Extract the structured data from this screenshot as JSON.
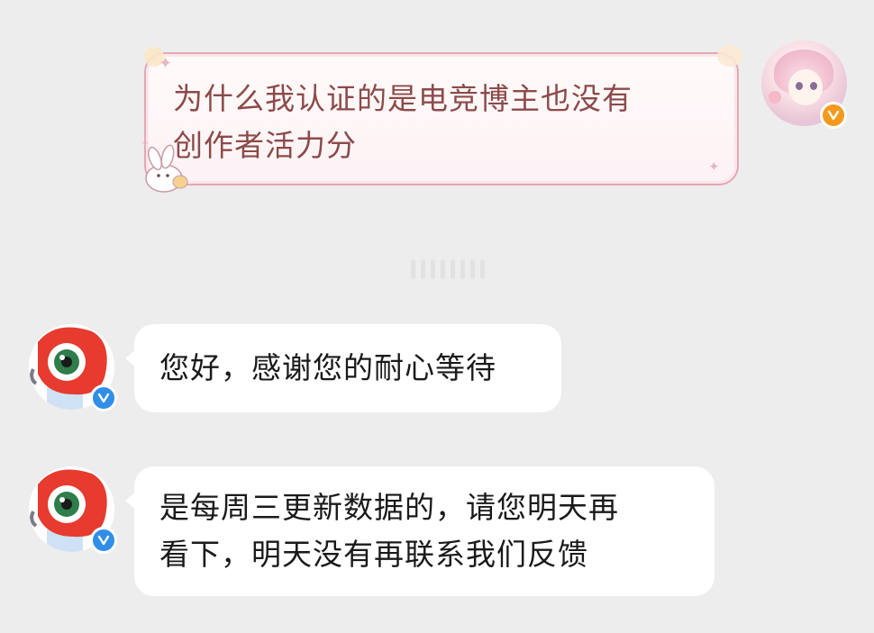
{
  "colors": {
    "background": "#ededed",
    "user_bubble_border": "#e5a7b6",
    "user_text": "#8c4a4a",
    "bot_bubble": "#ffffff",
    "bot_text": "#1a1a1a",
    "verified_blue": "#2f8ee8",
    "verified_orange": "#f39a1d"
  },
  "messages": [
    {
      "sender": "user",
      "avatar_icon": "anime-girl-avatar-icon",
      "badge_icon": "verified-orange-v-icon",
      "lines": [
        "为什么我认证的是电竞博主也没有",
        "创作者活力分"
      ]
    },
    {
      "sender": "service",
      "avatar_icon": "weibo-eye-mascot-avatar-icon",
      "badge_icon": "verified-blue-v-icon",
      "lines": [
        "您好，感谢您的耐心等待"
      ]
    },
    {
      "sender": "service",
      "avatar_icon": "weibo-eye-mascot-avatar-icon",
      "badge_icon": "verified-blue-v-icon",
      "lines": [
        "是每周三更新数据的，请您明天再",
        "看下，明天没有再联系我们反馈"
      ]
    }
  ]
}
